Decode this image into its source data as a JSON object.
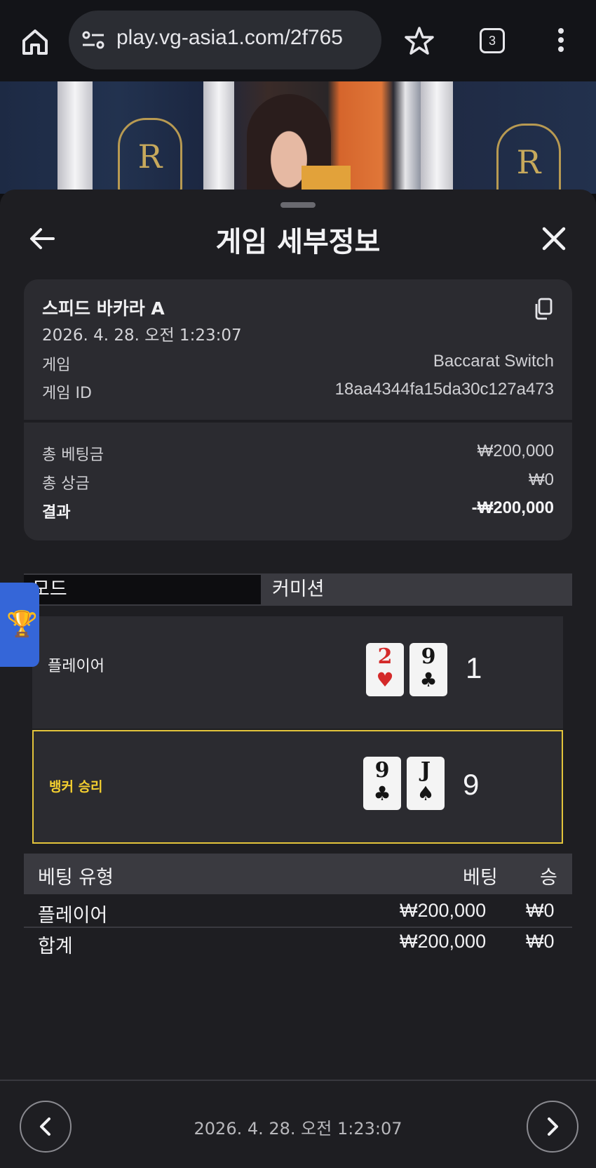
{
  "browser": {
    "url": "play.vg-asia1.com/2f765",
    "tab_count": "3"
  },
  "sheet": {
    "title": "게임 세부정보"
  },
  "summary": {
    "game_name": "스피드 바카라 A",
    "timestamp": "2026. 4. 28. 오전 1:23:07",
    "rows": [
      {
        "label": "게임",
        "value": "Baccarat Switch"
      },
      {
        "label": "게임 ID",
        "value": "18aa4344fa15da30c127a473"
      }
    ],
    "totals": [
      {
        "label": "총 베팅금",
        "value": "₩200,000"
      },
      {
        "label": "총 상금",
        "value": "₩0"
      },
      {
        "label": "결과",
        "value": "-₩200,000"
      }
    ]
  },
  "mode": {
    "left": "모드",
    "right": "커미션"
  },
  "hands": {
    "player": {
      "label": "플레이어",
      "cards": [
        {
          "rank": "2",
          "suit": "♥"
        },
        {
          "rank": "9",
          "suit": "♣"
        }
      ],
      "score": "1"
    },
    "banker": {
      "label": "뱅커 승리",
      "cards": [
        {
          "rank": "9",
          "suit": "♣"
        },
        {
          "rank": "J",
          "suit": "♠"
        }
      ],
      "score": "9"
    }
  },
  "bets": {
    "headers": [
      "베팅 유형",
      "베팅",
      "승"
    ],
    "rows": [
      {
        "type": "플레이어",
        "bet": "₩200,000",
        "win": "₩0"
      },
      {
        "type": "합계",
        "bet": "₩200,000",
        "win": "₩0"
      }
    ]
  },
  "footer": {
    "timestamp": "2026. 4. 28. 오전 1:23:07"
  },
  "colors": {
    "win_highlight": "#e3c43b",
    "card_red": "#d42a2a",
    "trophy_tab": "#3566d8"
  },
  "icons": [
    "home-icon",
    "tune-icon",
    "star-icon",
    "tabs-icon",
    "more-vert-icon",
    "arrow-left-icon",
    "close-icon",
    "copy-icon",
    "trophy-icon",
    "chevron-left-icon",
    "chevron-right-icon"
  ]
}
